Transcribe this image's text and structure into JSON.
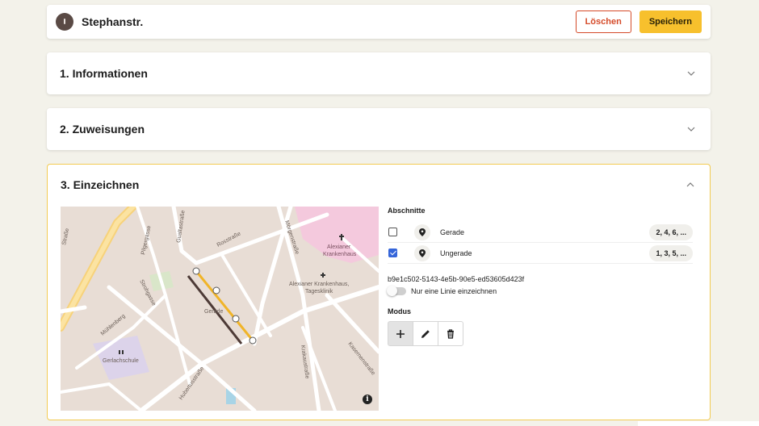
{
  "header": {
    "street_name": "Stephanstr.",
    "delete_label": "Löschen",
    "save_label": "Speichern"
  },
  "sections": [
    {
      "title": "1. Informationen",
      "expanded": false
    },
    {
      "title": "2. Zuweisungen",
      "expanded": false
    },
    {
      "title": "3. Einzeichnen",
      "expanded": true
    }
  ],
  "map": {
    "labels": {
      "alexianer": "Alexianer",
      "krankenhaus": "Krankenhaus",
      "alexianer2": "Alexianer Krankenhaus,",
      "tagesklinik": "Tagesklinik",
      "gerade": "Gerade",
      "gerlachschule": "Gerlachschule",
      "rosstrasse": "Rosstraße",
      "gualtastrasse": "Gualtastraße",
      "moergenstrasse": "Mörgenstraße",
      "strohgasse": "Strohgasse",
      "muehlenberg": "Mühlenberg",
      "hubertusstrasse": "Hubertusstraße",
      "krakaustrasse": "Krakaustraße",
      "kasernenstrasse": "Kasernenstraße",
      "pilgergasse": "Pilgergasse",
      "strasse": "Straße"
    },
    "info_glyph": "i",
    "colors": {
      "even_line": "#f0b428",
      "odd_line": "#4d3a36"
    }
  },
  "panel": {
    "segments_label": "Abschnitte",
    "segments": [
      {
        "name": "Gerade",
        "numbers": "2, 4, 6, ...",
        "checked": false
      },
      {
        "name": "Ungerade",
        "numbers": "1, 3, 5, ...",
        "checked": true
      }
    ],
    "uuid": "b9e1c502-5143-4e5b-90e5-ed53605d423f",
    "toggle_label": "Nur eine Linie einzeichnen",
    "modus_label": "Modus",
    "tools": [
      "plus-icon",
      "pencil-icon",
      "trash-icon"
    ]
  },
  "colors": {
    "accent": "#f7c02d",
    "danger": "#d54b2a",
    "checkbox": "#3565d9"
  }
}
